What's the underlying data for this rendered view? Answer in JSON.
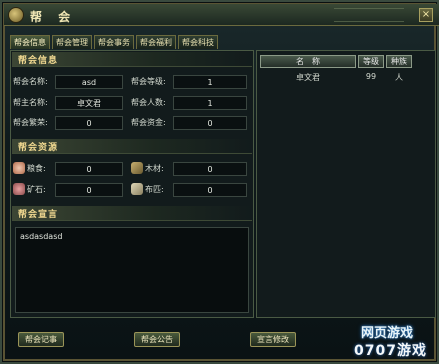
{
  "window": {
    "title": "帮 会",
    "close_label": "×"
  },
  "tabs": [
    {
      "label": "帮会信息",
      "active": true
    },
    {
      "label": "帮会管理",
      "active": false
    },
    {
      "label": "帮会事务",
      "active": false
    },
    {
      "label": "帮会福利",
      "active": false
    },
    {
      "label": "帮会科技",
      "active": false
    }
  ],
  "info": {
    "header": "帮会信息",
    "name_label": "帮会名称:",
    "name_value": "asd",
    "level_label": "帮会等级:",
    "level_value": "1",
    "leader_label": "帮主名称:",
    "leader_value": "卓文君",
    "members_label": "帮会人数:",
    "members_value": "1",
    "prosperity_label": "帮会繁荣:",
    "prosperity_value": "0",
    "funds_label": "帮会资金:",
    "funds_value": "0"
  },
  "resources": {
    "header": "帮会资源",
    "grain_label": "粮食:",
    "grain_value": "0",
    "wood_label": "木材:",
    "wood_value": "0",
    "ore_label": "矿石:",
    "ore_value": "0",
    "cloth_label": "布匹:",
    "cloth_value": "0"
  },
  "declaration": {
    "header": "帮会宣言",
    "text": "asdasdasd"
  },
  "member_table": {
    "columns": [
      "名　称",
      "等级",
      "种族"
    ],
    "rows": [
      {
        "name": "卓文君",
        "level": "99",
        "race": "人"
      }
    ]
  },
  "buttons": {
    "history": "帮会记事",
    "notice": "帮会公告",
    "edit_declaration": "宣言修改"
  },
  "watermark": {
    "line1": "网页游戏",
    "line2": "0707游戏"
  },
  "colors": {
    "accent_gold": "#f0d890",
    "panel_bg": "#121b1c",
    "border": "#4a5a44"
  }
}
